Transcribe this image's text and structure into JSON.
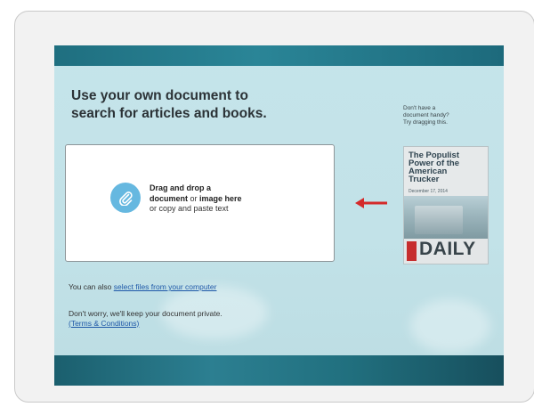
{
  "upload_panel": {
    "heading_line1": "Use your own document to",
    "heading_line2": "search for articles and books.",
    "dropzone": {
      "line1": "Drag and drop a",
      "line2_bold_a": "document",
      "line2_or": " or ",
      "line2_bold_b": "image here",
      "line3": "or copy and paste text",
      "icon": "paperclip-icon"
    },
    "also_prefix": "You can also ",
    "also_link": "select files from your computer",
    "privacy_text": "Don't worry, we'll keep your document private.",
    "terms_link": "(Terms & Conditions)"
  },
  "sample": {
    "note_line1": "Don't have a",
    "note_line2": "document handy?",
    "note_line3": "Try dragging this.",
    "arrow_icon": "left-arrow-icon",
    "magazine": {
      "title_line1": "The Populist",
      "title_line2": "Power of the",
      "title_line3": "American",
      "title_line4": "Trucker",
      "date": "December 17, 2014",
      "masthead": "DAILY"
    }
  },
  "colors": {
    "top_bar": "#2a8597",
    "background": "#c5e4ea",
    "link": "#1f59a8",
    "arrow": "#d42a2a",
    "icon_circle": "#66b8e0"
  }
}
